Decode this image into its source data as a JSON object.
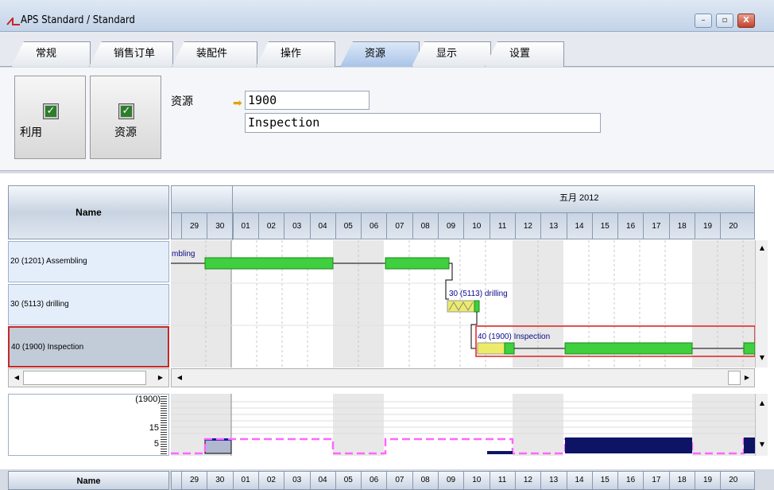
{
  "window": {
    "title": "APS Standard / Standard",
    "min": "–",
    "max": "▫",
    "close": "X"
  },
  "tabs": [
    "常规",
    "销售订单",
    "装配件",
    "操作",
    "资源",
    "显示",
    "设置"
  ],
  "active_tab": "资源",
  "toolbar": {
    "btn_use": "利用",
    "btn_resource": "资源",
    "field_label": "资源",
    "resource_id": "1900",
    "resource_name": "Inspection"
  },
  "gantt": {
    "name_header": "Name",
    "month_label": "五月 2012",
    "days": [
      "29",
      "30",
      "01",
      "02",
      "03",
      "04",
      "05",
      "06",
      "07",
      "08",
      "09",
      "10",
      "11",
      "12",
      "13",
      "14",
      "15",
      "16",
      "17",
      "18",
      "19",
      "20"
    ],
    "rows": [
      {
        "label": "20 (1201) Assembling"
      },
      {
        "label": "30 (5113) drilling"
      },
      {
        "label": "40 (1900) Inspection"
      }
    ],
    "bar_labels": {
      "assembling_partial": "mbling",
      "drilling": "30 (5113) drilling",
      "inspection": "40 (1900) Inspection"
    }
  },
  "load_chart": {
    "axis_top_label": "(1900)",
    "tick_15": "15",
    "tick_5": "5"
  },
  "bottom": {
    "name_header": "Name"
  },
  "colors": {
    "bar_green": "#3fcf3f",
    "load_navy": "#0d1466",
    "capacity_pink": "#ff66ff",
    "selected_border": "#c62828"
  }
}
